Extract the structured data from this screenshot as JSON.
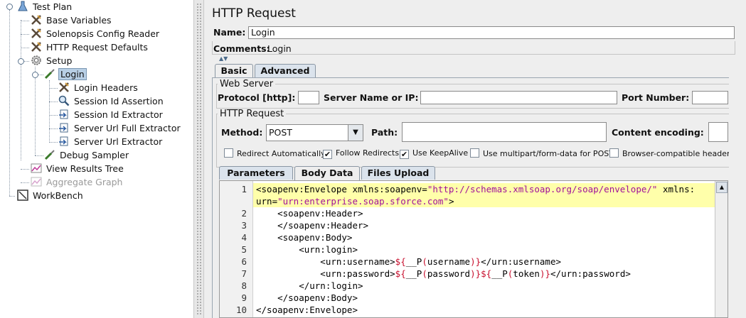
{
  "tree": {
    "items": [
      {
        "label": "Test Plan"
      },
      {
        "label": "Base Variables"
      },
      {
        "label": "Solenopsis Config Reader"
      },
      {
        "label": "HTTP Request Defaults"
      },
      {
        "label": "Setup"
      },
      {
        "label": "Login"
      },
      {
        "label": "Login Headers"
      },
      {
        "label": "Session Id Assertion"
      },
      {
        "label": "Session Id Extractor"
      },
      {
        "label": "Server Url Full Extractor"
      },
      {
        "label": "Server Url Extractor"
      },
      {
        "label": "Debug Sampler"
      },
      {
        "label": "View Results Tree"
      },
      {
        "label": "Aggregate Graph"
      },
      {
        "label": "WorkBench"
      }
    ]
  },
  "panel": {
    "title": "HTTP Request",
    "name_label": "Name:",
    "name_value": "Login",
    "comments_label": "Comments:",
    "comments_value": "Login",
    "tabs": [
      "Basic",
      "Advanced"
    ],
    "web_server": {
      "legend": "Web Server",
      "protocol_label": "Protocol [http]:",
      "protocol_value": "",
      "server_label": "Server Name or IP:",
      "server_value": "",
      "port_label": "Port Number:",
      "port_value": ""
    },
    "http_request": {
      "legend": "HTTP Request",
      "method_label": "Method:",
      "method_value": "POST",
      "path_label": "Path:",
      "path_value": "",
      "encoding_label": "Content encoding:",
      "encoding_value": ""
    },
    "checkboxes": [
      {
        "label": "Redirect Automatically",
        "checked": false
      },
      {
        "label": "Follow Redirects",
        "checked": true
      },
      {
        "label": "Use KeepAlive",
        "checked": true
      },
      {
        "label": "Use multipart/form-data for POST",
        "checked": false
      },
      {
        "label": "Browser-compatible headers",
        "checked": false
      }
    ],
    "body_tabs": [
      "Parameters",
      "Body Data",
      "Files Upload"
    ]
  },
  "editor": {
    "line_numbers": [
      "1",
      "",
      "2",
      "3",
      "4",
      "5",
      "6",
      "7",
      "8",
      "9",
      "10"
    ],
    "lines": [
      "<soapenv:Envelope xmlns:soapenv=\"http://schemas.xmlsoap.org/soap/envelope/\" xmlns:",
      "urn=\"urn:enterprise.soap.sforce.com\">",
      "    <soapenv:Header>",
      "    </soapenv:Header>",
      "    <soapenv:Body>",
      "        <urn:login>",
      "            <urn:username>${__P(username)}</urn:username>",
      "            <urn:password>${__P(password)}${__P(token)}</urn:password>",
      "        </urn:login>",
      "    </soapenv:Body>",
      "</soapenv:Envelope>"
    ]
  }
}
